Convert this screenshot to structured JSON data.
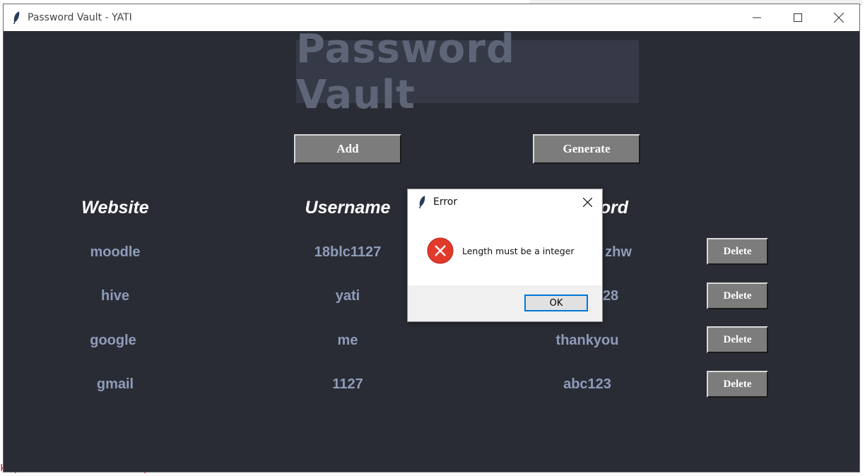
{
  "window": {
    "title": "Password Vault - YATI",
    "icon": "feather-icon"
  },
  "heading": "Password Vault",
  "buttons": {
    "add": "Add",
    "generate": "Generate",
    "delete": "Delete"
  },
  "columns": {
    "website": "Website",
    "username": "Username",
    "password": "Password"
  },
  "rows": [
    {
      "website": "moodle",
      "username": "18blc1127",
      "password": "zhw"
    },
    {
      "website": "hive",
      "username": "yati",
      "password": "28"
    },
    {
      "website": "google",
      "username": "me",
      "password": "thankyou"
    },
    {
      "website": "gmail",
      "username": "1127",
      "password": "abc123"
    }
  ],
  "dialog": {
    "title": "Error",
    "message": "Length must be a integer",
    "ok_label": "OK",
    "icon": "error-icon"
  },
  "background": {
    "code_text": "k (most recent call last):"
  },
  "colors": {
    "window_bg": "#2a2c35",
    "heading_bg": "#363a46",
    "heading_text": "#5e6577",
    "cell_text": "#8e9cb9",
    "button_bg": "#7c7c7c",
    "error_red": "#e23a2a",
    "ok_border": "#0078d7"
  }
}
